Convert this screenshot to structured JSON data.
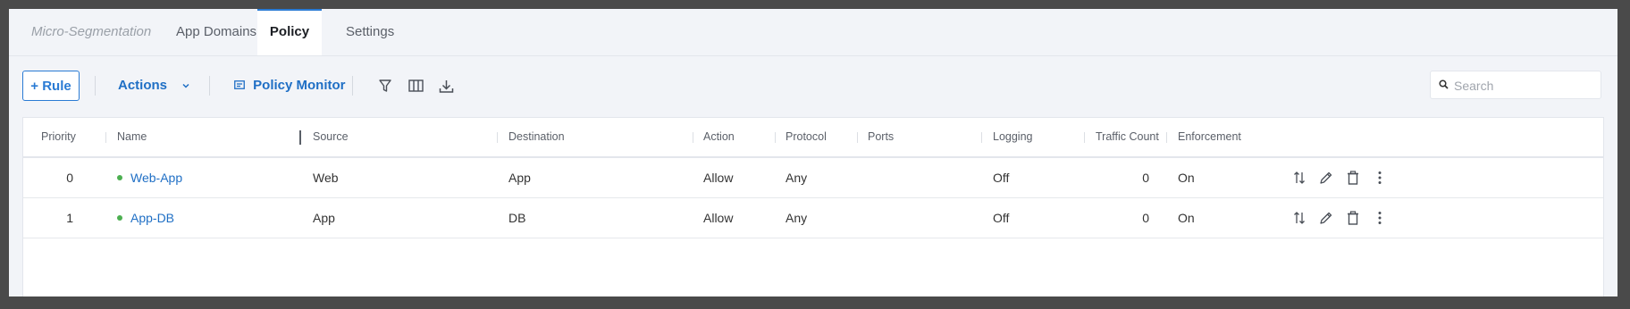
{
  "tabs": {
    "brand": "Micro-Segmentation",
    "items": [
      {
        "label": "App Domains"
      },
      {
        "label": "Policy"
      },
      {
        "label": "Settings"
      }
    ]
  },
  "toolbar": {
    "rule_label": "+ Rule",
    "actions_label": "Actions",
    "policy_monitor_label": "Policy Monitor",
    "search_placeholder": "Search"
  },
  "table": {
    "columns": [
      "Priority",
      "Name",
      "Source",
      "Destination",
      "Action",
      "Protocol",
      "Ports",
      "Logging",
      "Traffic Count",
      "Enforcement"
    ],
    "rows": [
      {
        "priority": "0",
        "name": "Web-App",
        "source": "Web",
        "destination": "App",
        "action": "Allow",
        "protocol": "Any",
        "ports": "",
        "logging": "Off",
        "traffic_count": "0",
        "enforcement": "On"
      },
      {
        "priority": "1",
        "name": "App-DB",
        "source": "App",
        "destination": "DB",
        "action": "Allow",
        "protocol": "Any",
        "ports": "",
        "logging": "Off",
        "traffic_count": "0",
        "enforcement": "On"
      }
    ]
  },
  "colors": {
    "accent": "#2a7bd4",
    "link": "#1f6fc5",
    "status_green": "#4caf50",
    "page_bg": "#f2f4f8"
  }
}
